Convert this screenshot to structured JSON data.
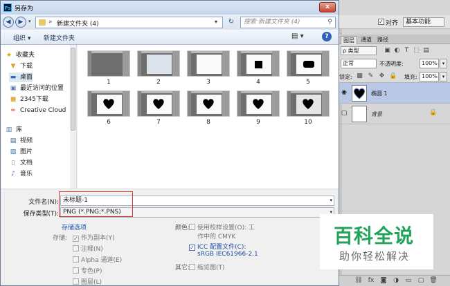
{
  "dialog": {
    "title": "另存为",
    "close_glyph": "x",
    "address": {
      "path": "新建文件夹 (4)",
      "search_placeholder": "搜索 新建文件夹 (4)"
    },
    "commands": {
      "organize": "组织 ▾",
      "new_folder": "新建文件夹",
      "view": "▤ ▾",
      "help": "?"
    },
    "nav_items": [
      {
        "label": "收藏夹",
        "icon": "star-icon"
      },
      {
        "label": "下载",
        "icon": "download-folder-icon"
      },
      {
        "label": "桌面",
        "icon": "desktop-icon"
      },
      {
        "label": "最近访问的位置",
        "icon": "recent-places-icon"
      },
      {
        "label": "2345下载",
        "icon": "folder-icon"
      },
      {
        "label": "Creative Cloud",
        "icon": "creative-cloud-icon"
      },
      {
        "label": "库",
        "icon": "library-icon"
      },
      {
        "label": "视频",
        "icon": "video-icon"
      },
      {
        "label": "图片",
        "icon": "pictures-icon"
      },
      {
        "label": "文档",
        "icon": "documents-icon"
      },
      {
        "label": "音乐",
        "icon": "music-icon"
      }
    ],
    "files": [
      {
        "label": "1",
        "shape": "none"
      },
      {
        "label": "2",
        "shape": "dialog"
      },
      {
        "label": "3",
        "shape": "canvas"
      },
      {
        "label": "4",
        "shape": "square"
      },
      {
        "label": "5",
        "shape": "rounded"
      },
      {
        "label": "6",
        "shape": "heart"
      },
      {
        "label": "7",
        "shape": "heart-black"
      },
      {
        "label": "8",
        "shape": "heart"
      },
      {
        "label": "9",
        "shape": "heart"
      },
      {
        "label": "10",
        "shape": "heart"
      }
    ],
    "form": {
      "filename_label": "文件名(N):",
      "filename_value": "未标题-1",
      "filetype_label": "保存类型(T):",
      "filetype_value": "PNG (*.PNG;*.PNS)"
    },
    "save_options": {
      "title": "存储选项",
      "store_label": "存储:",
      "items": [
        "作为副本(Y)",
        "注释(N)",
        "Alpha 通道(E)",
        "专色(P)",
        "图层(L)"
      ]
    },
    "color": {
      "label": "颜色:",
      "proof_line1": "使用校样设置(O): 工",
      "proof_line2": "作中的 CMYK",
      "icc_line1": "ICC 配置文件(C):",
      "icc_line2": "sRGB IEC61966-2.1"
    },
    "other": {
      "label": "其它:",
      "thumbnail": "缩览图(T)"
    }
  },
  "photoshop": {
    "align_label": "对齐",
    "workspace": "基本功能",
    "panel_tabs": [
      "图层",
      "通道",
      "路径"
    ],
    "filter_kind": "ρ 类型",
    "blend_mode": "正常",
    "opacity_label": "不透明度:",
    "opacity_value": "100%",
    "lock_label": "锁定:",
    "fill_label": "填充:",
    "fill_value": "100%",
    "layers": [
      {
        "name": "椭圆 1",
        "selected": true
      },
      {
        "name": "背景",
        "selected": false
      }
    ]
  },
  "watermark": {
    "title": "百科全说",
    "subtitle": "助你轻松解决"
  },
  "colors": {
    "accent": "#1a56b0",
    "watermark_green": "#22a35a",
    "highlight": "#e03030"
  }
}
